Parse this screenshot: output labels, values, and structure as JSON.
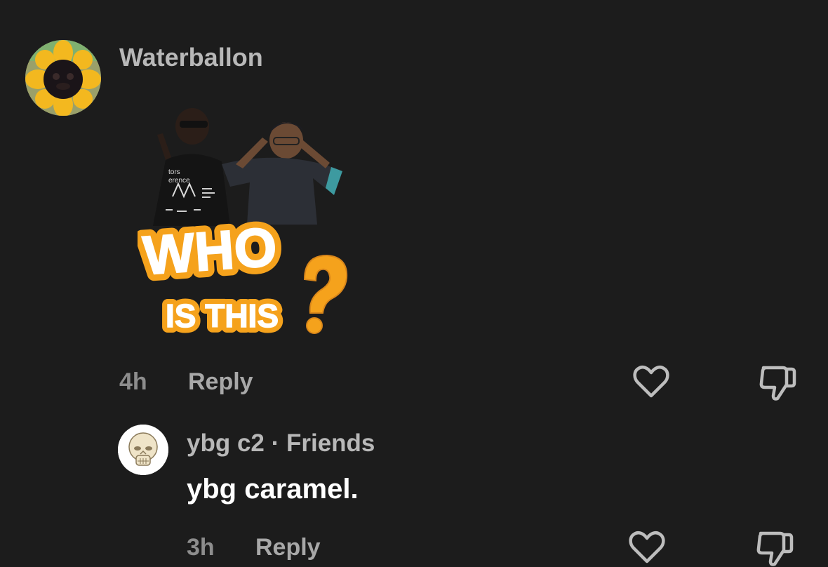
{
  "comments": [
    {
      "username": "Waterballon",
      "avatar_icon": "sunflower-avatar-icon",
      "sticker": {
        "line1": "WHO",
        "line2": "IS THIS",
        "icon": "who-is-this-sticker"
      },
      "time": "4h",
      "reply_label": "Reply",
      "like_icon": "heart-icon",
      "dislike_icon": "thumbs-down-icon"
    },
    {
      "username": "ybg c2 · Friends",
      "avatar_icon": "skull-avatar-icon",
      "text": "ybg caramel.",
      "time": "3h",
      "reply_label": "Reply",
      "like_icon": "heart-icon",
      "dislike_icon": "thumbs-down-icon"
    }
  ],
  "colors": {
    "background": "#1c1c1c",
    "username": "#b8b8b8",
    "meta": "#8d8d8d",
    "text": "#ffffff",
    "sticker_orange": "#f5a21c"
  }
}
